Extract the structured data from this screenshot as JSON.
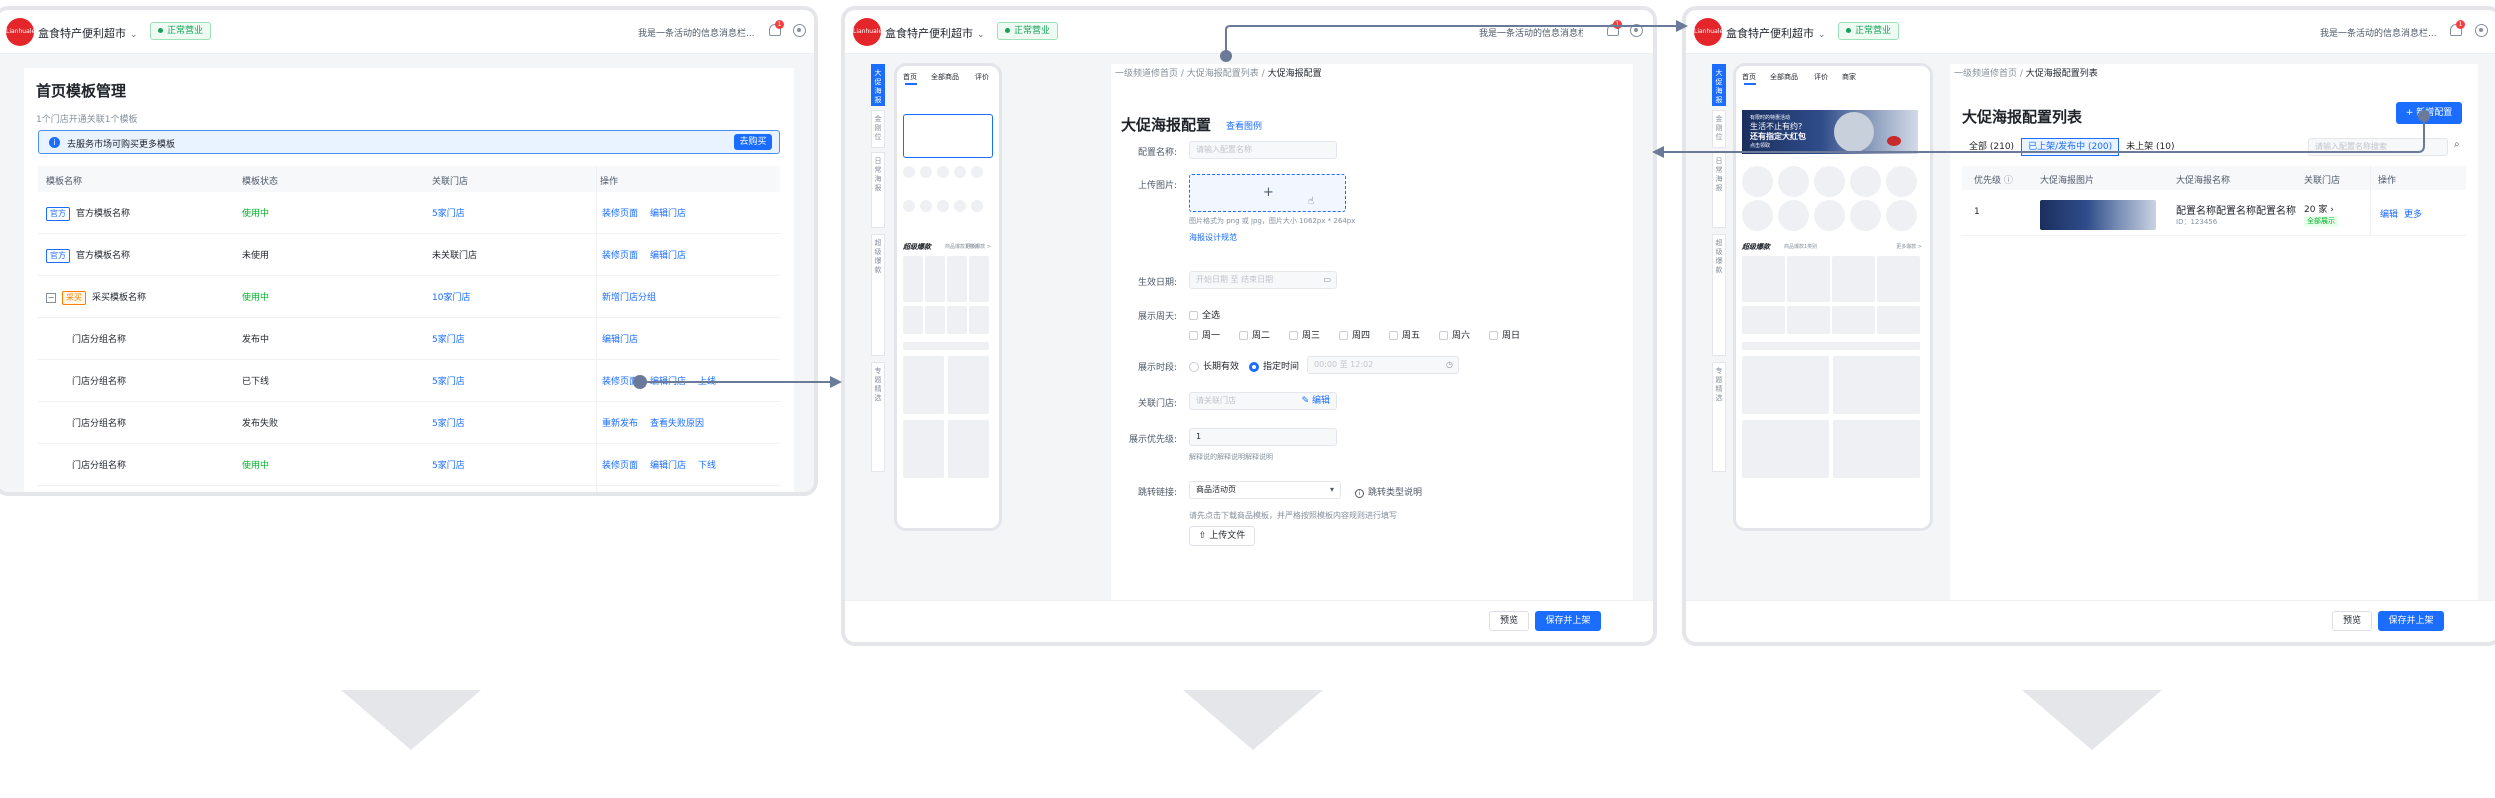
{
  "common": {
    "logo_text": "Lianhuale",
    "store_name": "盒食特产便利超市",
    "status": "正常营业",
    "notice": "我是一条活动的信息消息栏...",
    "badge": "1"
  },
  "frame1": {
    "title": "首页模板管理",
    "subtitle": "1个门店开通关联1个模板",
    "info_text": "去服务市场可购买更多模板",
    "info_button": "去购买",
    "columns": [
      "模板名称",
      "模板状态",
      "关联门店",
      "操作"
    ],
    "rows": [
      {
        "tag": "官方",
        "name": "官方模板名称",
        "status": "使用中",
        "stores": "5家门店",
        "actions": [
          "装修页面",
          "编辑门店"
        ],
        "status_color": "#00b42a"
      },
      {
        "tag": "官方",
        "name": "官方模板名称",
        "status": "未使用",
        "stores": "未关联门店",
        "actions": [
          "装修页面",
          "编辑门店"
        ],
        "status_color": "#1f2329"
      },
      {
        "tag": "采买",
        "name": "采买模板名称",
        "status": "使用中",
        "stores": "10家门店",
        "actions": [
          "新增门店分组"
        ],
        "status_color": "#00b42a"
      },
      {
        "tag": "",
        "name": "门店分组名称",
        "status": "发布中",
        "stores": "5家门店",
        "actions": [
          "编辑门店"
        ],
        "status_color": "#1f2329"
      },
      {
        "tag": "",
        "name": "门店分组名称",
        "status": "已下线",
        "stores": "5家门店",
        "actions": [
          "装修页面",
          "编辑门店",
          "上线"
        ],
        "status_color": "#1f2329"
      },
      {
        "tag": "",
        "name": "门店分组名称",
        "status": "发布失败",
        "stores": "5家门店",
        "actions": [
          "重新发布",
          "查看失败原因"
        ],
        "status_color": "#1f2329"
      },
      {
        "tag": "",
        "name": "门店分组名称",
        "status": "使用中",
        "stores": "5家门店",
        "actions": [
          "装修页面",
          "编辑门店",
          "下线"
        ],
        "status_color": "#00b42a"
      }
    ]
  },
  "phone": {
    "tabs": [
      "首页",
      "全部商品",
      "评价",
      "商家"
    ],
    "section_title": "超级爆款",
    "section_sub": "商品爆款1类别",
    "section_more": "更多爆款 >",
    "side_tabs": [
      "大促海报",
      "金刚位",
      "日常海报",
      "超级爆款",
      "专题精选"
    ]
  },
  "frame2": {
    "breadcrumb": [
      "一级频道修首页",
      "大促海报配置列表",
      "大促海报配置"
    ],
    "title": "大促海报配置",
    "example_link": "查看图例",
    "fields": {
      "name_label": "配置名称:",
      "name_placeholder": "请输入配置名称",
      "image_label": "上传图片:",
      "image_hint": "图片格式为 png 或 jpg，图片大小 1062px * 264px",
      "design_link": "海报设计规范",
      "date_label": "生效日期:",
      "date_placeholder": "开始日期 至 结束日期",
      "week_label": "展示周天:",
      "week_all": "全选",
      "week_days": [
        "周一",
        "周二",
        "周三",
        "周四",
        "周五",
        "周六",
        "周日"
      ],
      "time_label": "展示时段:",
      "time_opt1": "长期有效",
      "time_opt2": "指定时间",
      "time_placeholder": "00:00 至 12:02",
      "store_label": "关联门店:",
      "store_placeholder": "请关联门店",
      "store_edit": "编辑",
      "priority_label": "展示优先级:",
      "priority_value": "1",
      "priority_hint": "解释说的解释说明解释说明",
      "jump_label": "跳转链接:",
      "jump_value": "商品活动页",
      "jump_help": "跳转类型说明",
      "jump_hint": "请先点击下载商品模板，并严格按照模板内容规则进行填写",
      "upload_file": "上传文件"
    },
    "buttons": {
      "preview": "预览",
      "save": "保存并上架"
    }
  },
  "frame3": {
    "breadcrumb": [
      "一级频道修首页",
      "大促海报配置列表"
    ],
    "title": "大促海报配置列表",
    "new_button": "+ 新增配置",
    "tabs": [
      "全部 (210)",
      "已上架/发布中 (200)",
      "未上架 (10)"
    ],
    "search_placeholder": "请输入配置名称搜索",
    "columns": [
      "优先级",
      "大促海报图片",
      "大促海报名称",
      "关联门店",
      "操作"
    ],
    "row": {
      "priority": "1",
      "name": "配置名称配置名称配置名称",
      "id": "ID：123456",
      "stores": "20 家",
      "store_status": "全部展示",
      "actions": [
        "编辑",
        "更多"
      ]
    },
    "banner": {
      "line1": "有限时的特惠活动",
      "line2": "生活不止有约?",
      "line3": "还有指定大红包",
      "line4": "点击领取"
    },
    "buttons": {
      "preview": "预览",
      "save": "保存并上架"
    }
  }
}
